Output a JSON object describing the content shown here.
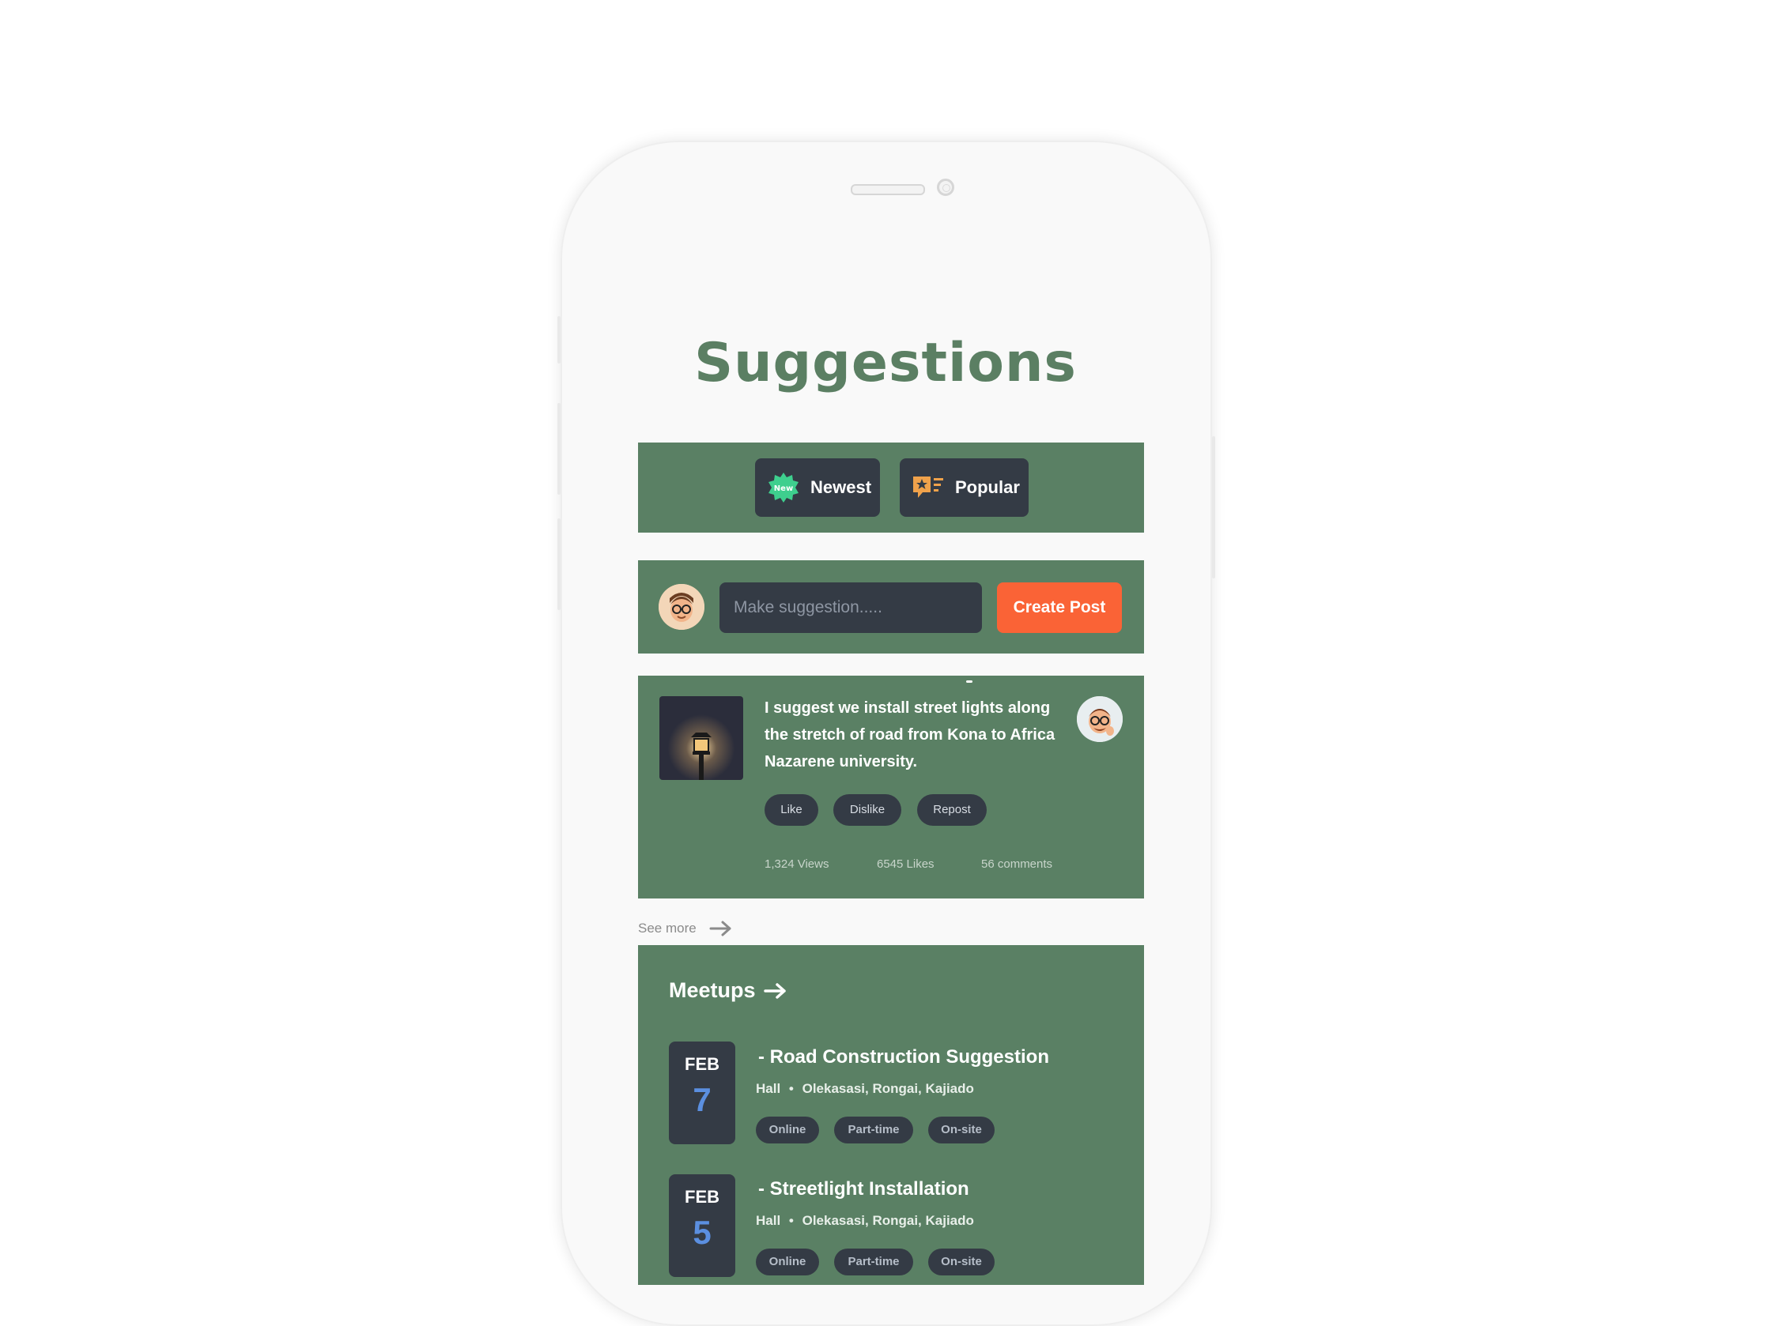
{
  "page": {
    "title": "Suggestions"
  },
  "filters": [
    {
      "label": "Newest",
      "icon": "new-badge-icon",
      "badge_text": "New",
      "accent": "#3ecf8e"
    },
    {
      "label": "Popular",
      "icon": "star-list-icon",
      "accent": "#f0a24b"
    }
  ],
  "composer": {
    "placeholder": "Make suggestion.....",
    "button_label": "Create Post"
  },
  "post": {
    "text": "I suggest we install street lights along  the stretch of road from Kona to Africa Nazarene university.",
    "actions": [
      "Like",
      "Dislike",
      "Repost"
    ],
    "stats": {
      "views": "1,324 Views",
      "likes": "6545 Likes",
      "comments": "56 comments"
    }
  },
  "see_more": "See more",
  "meetups": {
    "title": "Meetups",
    "events": [
      {
        "month": "FEB",
        "day": "7",
        "title": "- Road Construction Suggestion",
        "venue": "Hall",
        "location": "Olekasasi, Rongai, Kajiado",
        "tags": [
          "Online",
          "Part-time",
          "On-site"
        ]
      },
      {
        "month": "FEB",
        "day": "5",
        "title": "- Streetlight Installation",
        "venue": "Hall",
        "location": "Olekasasi, Rongai, Kajiado",
        "tags": [
          "Online",
          "Part-time",
          "On-site"
        ]
      }
    ]
  },
  "colors": {
    "brand_green": "#5a8064",
    "title_green": "#5b7f63",
    "dark_chip": "#343b45",
    "cta_orange": "#fa6336",
    "date_blue": "#5b8fe0"
  }
}
